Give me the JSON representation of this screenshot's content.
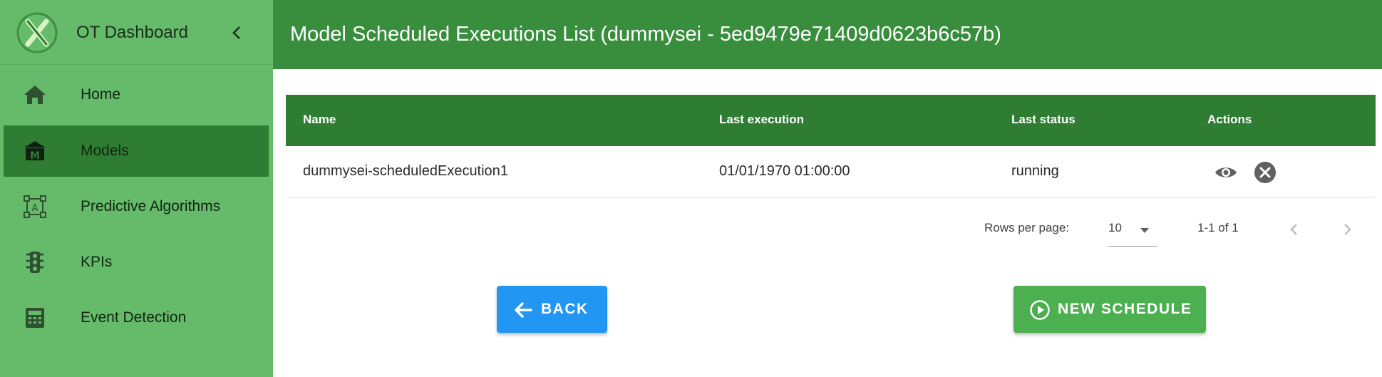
{
  "app": {
    "title": "OT Dashboard"
  },
  "sidebar": {
    "items": [
      {
        "label": "Home",
        "icon": "home-icon",
        "active": false
      },
      {
        "label": "Models",
        "icon": "models-icon",
        "active": true
      },
      {
        "label": "Predictive Algorithms",
        "icon": "algorithm-icon",
        "active": false
      },
      {
        "label": "KPIs",
        "icon": "traffic-light-icon",
        "active": false
      },
      {
        "label": "Event Detection",
        "icon": "calculator-icon",
        "active": false
      }
    ]
  },
  "header": {
    "title": "Model Scheduled Executions List (dummysei - 5ed9479e71409d0623b6c57b)"
  },
  "table": {
    "columns": [
      "Name",
      "Last execution",
      "Last status",
      "Actions"
    ],
    "rows": [
      {
        "name": "dummysei-scheduledExecution1",
        "last_execution": "01/01/1970 01:00:00",
        "last_status": "running"
      }
    ]
  },
  "pagination": {
    "rows_per_page_label": "Rows per page:",
    "rows_per_page": "10",
    "range": "1-1 of 1"
  },
  "buttons": {
    "back": "BACK",
    "new_schedule": "NEW SCHEDULE"
  },
  "colors": {
    "sidebar": "#66bb6a",
    "header": "#388e3c",
    "table_header": "#2e7d32",
    "active_nav": "#2e7d32",
    "back_button": "#2196f3",
    "new_schedule_button": "#4caf50"
  }
}
